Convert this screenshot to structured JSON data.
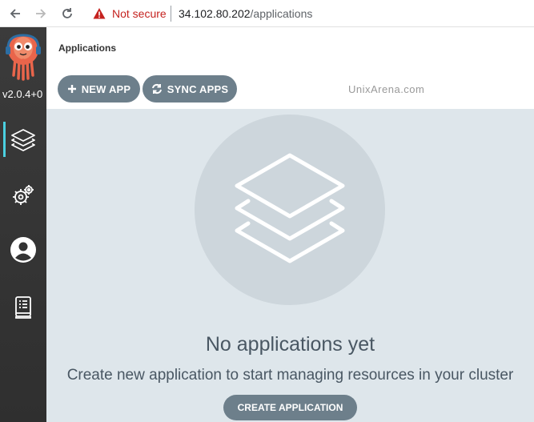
{
  "browser": {
    "security_label": "Not secure",
    "url_host": "34.102.80.202",
    "url_path": "/applications"
  },
  "sidebar": {
    "version": "v2.0.4+0",
    "items": [
      {
        "name": "applications",
        "icon": "layers-icon",
        "active": true
      },
      {
        "name": "settings",
        "icon": "gear-icon",
        "active": false
      },
      {
        "name": "user-info",
        "icon": "user-icon",
        "active": false
      },
      {
        "name": "documentation",
        "icon": "book-icon",
        "active": false
      }
    ]
  },
  "header": {
    "title": "Applications"
  },
  "toolbar": {
    "new_app_label": "NEW APP",
    "sync_apps_label": "SYNC APPS",
    "watermark": "UnixArena.com"
  },
  "empty_state": {
    "title": "No applications yet",
    "subtitle": "Create new application to start managing resources in your cluster",
    "create_label": "CREATE APPLICATION"
  },
  "colors": {
    "sidebar_bg": "#333333",
    "active_indicator": "#4bd0e0",
    "button_bg": "#6d7f8b",
    "main_bg": "#dee6eb",
    "warning_red": "#c5221f"
  }
}
